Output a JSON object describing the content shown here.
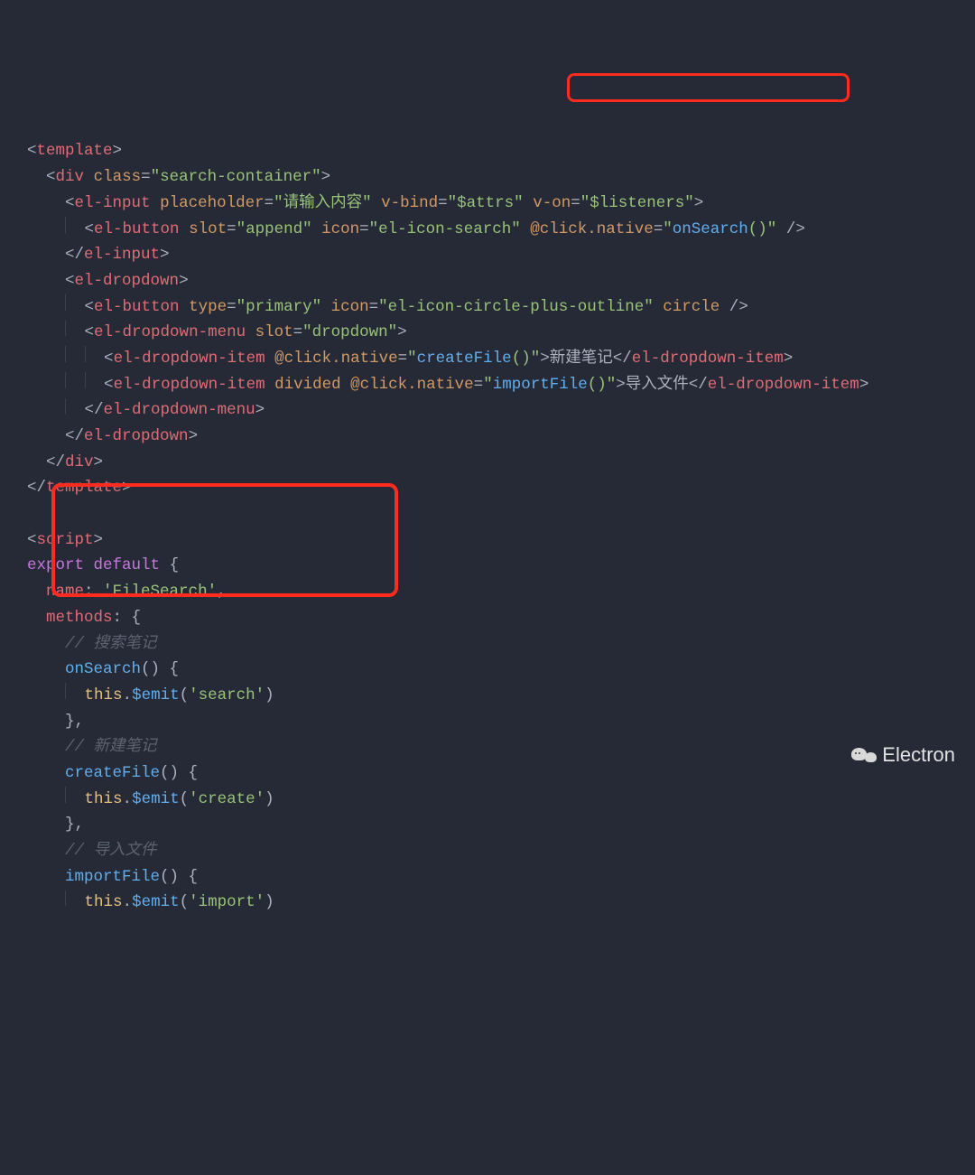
{
  "code": {
    "l01": "template",
    "l02": {
      "tag": "div",
      "cls": "class",
      "clsval": "\"search-container\""
    },
    "l03": {
      "tag": "el-input",
      "a1": "placeholder",
      "v1": "\"请输入内容\"",
      "a2": "v-bind",
      "v2": "\"$attrs\"",
      "a3": "v-on",
      "v3": "\"$listeners\""
    },
    "l04": {
      "tag": "el-button",
      "a1": "slot",
      "v1": "\"append\"",
      "a2": "icon",
      "v2": "\"el-icon-search\"",
      "a3": "@click.native",
      "v3p": "\"",
      "v3f": "onSearch",
      "v3s": "()\""
    },
    "l05": "el-input",
    "l06": "el-dropdown",
    "l07": {
      "tag": "el-button",
      "a1": "type",
      "v1": "\"primary\"",
      "a2": "icon",
      "v2": "\"el-icon-circle-plus-outline\"",
      "a3": "circle"
    },
    "l08": {
      "tag": "el-dropdown-menu",
      "a1": "slot",
      "v1": "\"dropdown\""
    },
    "l09": {
      "tag": "el-dropdown-item",
      "a1": "@click.native",
      "v1p": "\"",
      "f": "createFile",
      "v1s": "()\"",
      "txt": "新建笔记"
    },
    "l10": {
      "tag": "el-dropdown-item",
      "a1": "divided",
      "a2": "@click.native",
      "v2p": "\"",
      "f": "importFile",
      "v2s": "()\"",
      "txt": "导入文件"
    },
    "l11": "el-dropdown-menu",
    "l12": "el-dropdown",
    "l13": "div",
    "l14": "template",
    "l15": "script",
    "l16": {
      "e": "export",
      "d": "default",
      "b": "{"
    },
    "l17": {
      "k": "name",
      "v": "'FileSearch'"
    },
    "l18": {
      "k": "methods",
      "b": "{"
    },
    "l19": "// 搜索笔记",
    "l20": {
      "fn": "onSearch",
      "sig": "() {"
    },
    "l21": {
      "t": "this",
      "d": ".",
      "e": "$emit",
      "a": "(",
      "s": "'search'",
      "c": ")"
    },
    "l22": "},",
    "l23": "// 新建笔记",
    "l24": {
      "fn": "createFile",
      "sig": "() {"
    },
    "l25": {
      "t": "this",
      "d": ".",
      "e": "$emit",
      "a": "(",
      "s": "'create'",
      "c": ")"
    },
    "l26": "},",
    "l27": "// 导入文件",
    "l28": {
      "fn": "importFile",
      "sig": "() {"
    },
    "l29": {
      "t": "this",
      "d": ".",
      "e": "$emit",
      "a": "(",
      "s": "'import'",
      "c": ")"
    }
  },
  "watermark": "Electron"
}
